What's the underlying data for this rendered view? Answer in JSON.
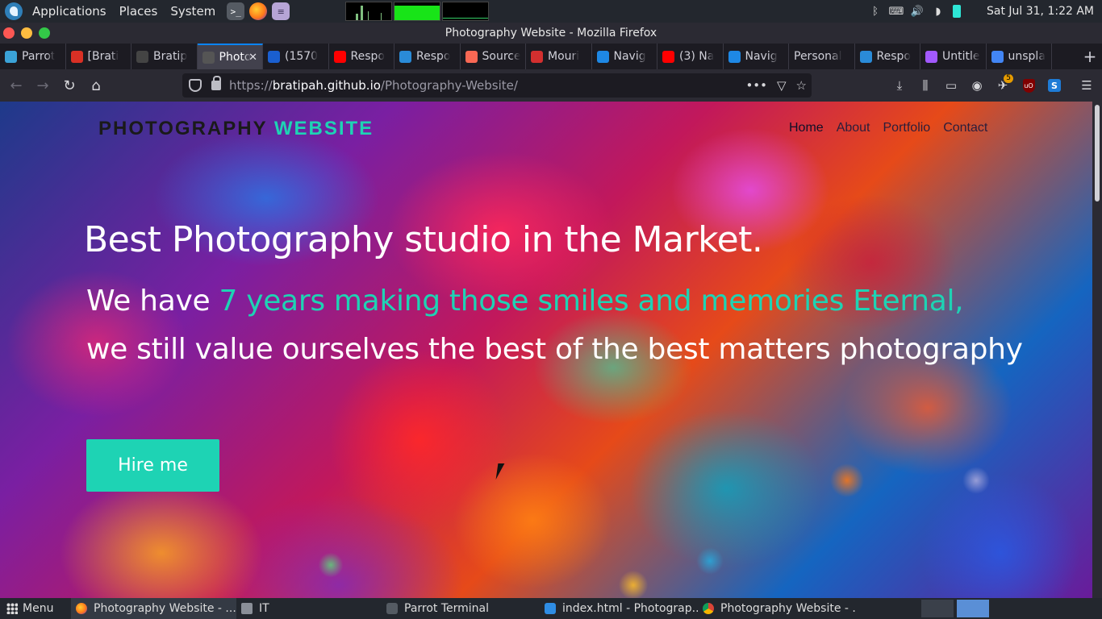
{
  "top_panel": {
    "menus": [
      "Applications",
      "Places",
      "System"
    ],
    "clock": "Sat Jul 31,  1:22 AM"
  },
  "window": {
    "title": "Photography Website - Mozilla Firefox"
  },
  "tabs": [
    {
      "label": "Parrot",
      "icon": "parrot-icon",
      "color": "#3ba3d8"
    },
    {
      "label": "[Brati",
      "icon": "gmail-icon",
      "color": "#d93025"
    },
    {
      "label": "Bratip",
      "icon": "github-icon",
      "color": "#444444"
    },
    {
      "label": "Photo",
      "icon": "page-icon",
      "color": "#555555",
      "active": true
    },
    {
      "label": "(1570",
      "icon": "atom-icon",
      "color": "#1a5fd0"
    },
    {
      "label": "Respo",
      "icon": "youtube-icon",
      "color": "#ff0000"
    },
    {
      "label": "Respo",
      "icon": "coding-ninjas-icon",
      "color": "#2a8bd8"
    },
    {
      "label": "Source",
      "icon": "patreon-icon",
      "color": "#f96854"
    },
    {
      "label": "Mouri",
      "icon": "d-icon",
      "color": "#d32f2f"
    },
    {
      "label": "Navig",
      "icon": "c-icon",
      "color": "#1e88e5"
    },
    {
      "label": "(3) Na",
      "icon": "youtube-icon",
      "color": "#ff0000"
    },
    {
      "label": "Navig",
      "icon": "c-icon",
      "color": "#1e88e5"
    },
    {
      "label": "Personal",
      "icon": "",
      "color": ""
    },
    {
      "label": "Respo",
      "icon": "coding-ninjas-icon",
      "color": "#2a8bd8"
    },
    {
      "label": "Untitle",
      "icon": "figma-icon",
      "color": "#a259ff"
    },
    {
      "label": "unspla",
      "icon": "google-icon",
      "color": "#4285f4"
    }
  ],
  "urlbar": {
    "prefix": "https://",
    "host": "bratipah.github.io",
    "path": "/Photography-Website/"
  },
  "site": {
    "brand_part1": "PHOTOGRAPHY",
    "brand_part2": "WEBSITE",
    "nav": [
      "Home",
      "About",
      "Portfolio",
      "Contact"
    ],
    "headline": "Best Photography studio in the Market.",
    "sub_before": "We have ",
    "sub_accent": "7 years making those smiles and memories Eternal,",
    "sub_after": "we still value ourselves the best of the best matters photography",
    "cta": "Hire me"
  },
  "colors": {
    "accent": "#1ed3b4",
    "active_tab_border": "#0a84ff"
  },
  "taskbar": {
    "menu": "Menu",
    "items": [
      {
        "label": "Photography Website - ...",
        "icon": "firefox-icon",
        "active": true
      },
      {
        "label": "IT",
        "icon": "folder-icon"
      },
      {
        "label": "Parrot Terminal",
        "icon": "terminal-icon"
      },
      {
        "label": "index.html - Photograp...",
        "icon": "vscode-icon"
      },
      {
        "label": "Photography Website - ...",
        "icon": "chrome-icon"
      }
    ]
  }
}
